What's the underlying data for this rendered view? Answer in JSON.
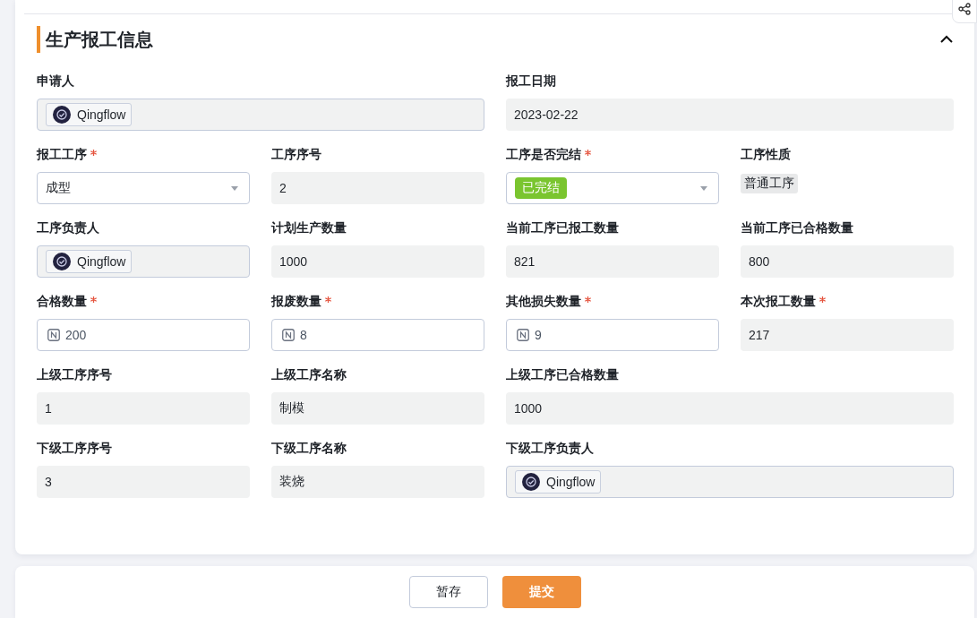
{
  "section": {
    "title": "生产报工信息",
    "expanded": true
  },
  "rows": [
    [
      {
        "label": "申请人",
        "required": false,
        "kind": "user",
        "value": "Qingflow"
      },
      {
        "label": "报工日期",
        "required": false,
        "kind": "text",
        "value": "2023-02-22"
      }
    ],
    [
      {
        "label": "报工工序",
        "required": true,
        "kind": "select",
        "value": "成型"
      },
      {
        "label": "工序序号",
        "required": false,
        "kind": "text",
        "value": "2"
      },
      {
        "label": "工序是否完结",
        "required": true,
        "kind": "status",
        "value": "已完结"
      },
      {
        "label": "工序性质",
        "required": false,
        "kind": "tag",
        "value": "普通工序"
      }
    ],
    [
      {
        "label": "工序负责人",
        "required": false,
        "kind": "user",
        "value": "Qingflow"
      },
      {
        "label": "计划生产数量",
        "required": false,
        "kind": "text",
        "value": "1000"
      },
      {
        "label": "当前工序已报工数量",
        "required": false,
        "kind": "text",
        "value": "821"
      },
      {
        "label": "当前工序已合格数量",
        "required": false,
        "kind": "text",
        "value": "800"
      }
    ],
    [
      {
        "label": "合格数量",
        "required": true,
        "kind": "number",
        "value": "200"
      },
      {
        "label": "报废数量",
        "required": true,
        "kind": "number",
        "value": "8"
      },
      {
        "label": "其他损失数量",
        "required": true,
        "kind": "number",
        "value": "9"
      },
      {
        "label": "本次报工数量",
        "required": true,
        "kind": "text",
        "value": "217"
      }
    ],
    [
      {
        "label": "上级工序序号",
        "required": false,
        "kind": "text",
        "value": "1"
      },
      {
        "label": "上级工序名称",
        "required": false,
        "kind": "text",
        "value": "制模"
      },
      {
        "label": "上级工序已合格数量",
        "required": false,
        "kind": "text",
        "value": "1000"
      }
    ],
    [
      {
        "label": "下级工序序号",
        "required": false,
        "kind": "text",
        "value": "3"
      },
      {
        "label": "下级工序名称",
        "required": false,
        "kind": "text",
        "value": "装烧"
      },
      {
        "label": "下级工序负责人",
        "required": false,
        "kind": "user",
        "value": "Qingflow"
      }
    ]
  ],
  "buttons": [
    {
      "label": "暂存",
      "kind": "secondary"
    },
    {
      "label": "提交",
      "kind": "primary"
    }
  ]
}
